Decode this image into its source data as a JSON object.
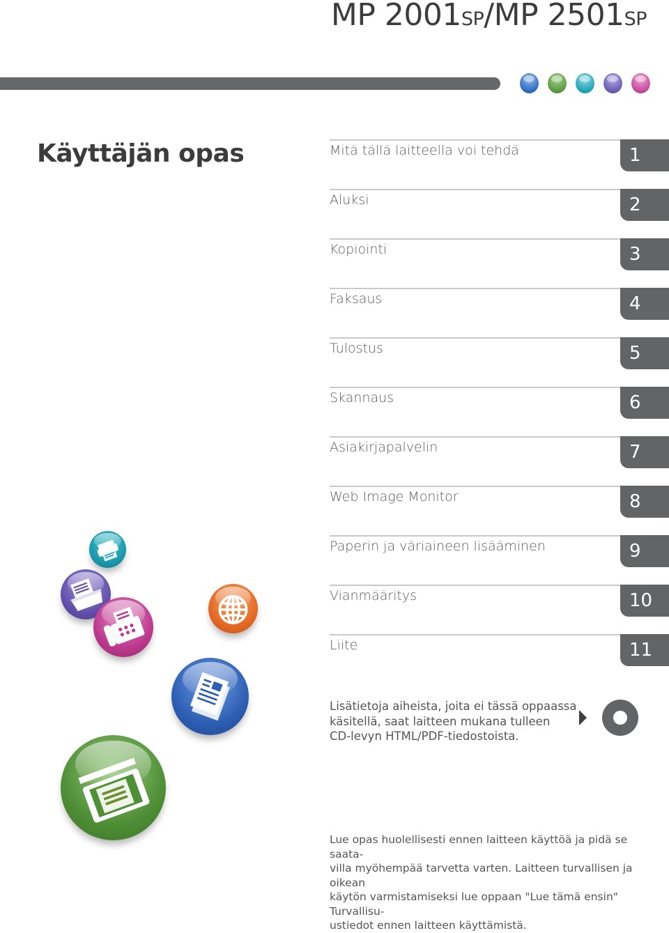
{
  "header": {
    "model_part1": "MP 2001",
    "model_sp1": "SP",
    "model_sep": "/MP 2501",
    "model_sp2": "SP"
  },
  "color_dots": [
    {
      "name": "blue",
      "color": "#3f7fd0"
    },
    {
      "name": "green",
      "color": "#5f9c45"
    },
    {
      "name": "teal",
      "color": "#1ea4b4"
    },
    {
      "name": "purple",
      "color": "#6a5bb5"
    },
    {
      "name": "pink",
      "color": "#c44a9c"
    }
  ],
  "document_title": "Käyttäjän opas",
  "toc": [
    {
      "label": "Mitä tällä laitteella voi tehdä",
      "chapter": "1"
    },
    {
      "label": "Aluksi",
      "chapter": "2"
    },
    {
      "label": "Kopiointi",
      "chapter": "3"
    },
    {
      "label": "Faksaus",
      "chapter": "4"
    },
    {
      "label": "Tulostus",
      "chapter": "5"
    },
    {
      "label": "Skannaus",
      "chapter": "6"
    },
    {
      "label": "Asiakirjapalvelin",
      "chapter": "7"
    },
    {
      "label": "Web Image Monitor",
      "chapter": "8"
    },
    {
      "label": "Paperin ja väriaineen lisääminen",
      "chapter": "9"
    },
    {
      "label": "Vianmääritys",
      "chapter": "10"
    },
    {
      "label": "Liite",
      "chapter": "11"
    }
  ],
  "cd_note": "Lisätietoja aiheista, joita ei tässä oppaassa\nkäsitellä, saat laitteen mukana tulleen\nCD-levyn HTML/PDF-tiedostoista.",
  "footer_note": "Lue opas huolellisesti ennen laitteen käyttöä ja pidä se saata-\nvilla myöhempää tarvetta varten. Laitteen turvallisen ja oikean\nkäytön varmistamiseksi lue oppaan \"Lue tämä ensin\" Turvallisu-\nustiedot ennen laitteen käyttämistä.",
  "function_icons": [
    {
      "name": "printer",
      "color": "#1c9aae"
    },
    {
      "name": "document-server",
      "color": "#6451ad"
    },
    {
      "name": "fax",
      "color": "#bd3a8e"
    },
    {
      "name": "web-globe",
      "color": "#e46a25"
    },
    {
      "name": "copy",
      "color": "#2d5fb5"
    },
    {
      "name": "scanner",
      "color": "#4f8f36"
    }
  ]
}
